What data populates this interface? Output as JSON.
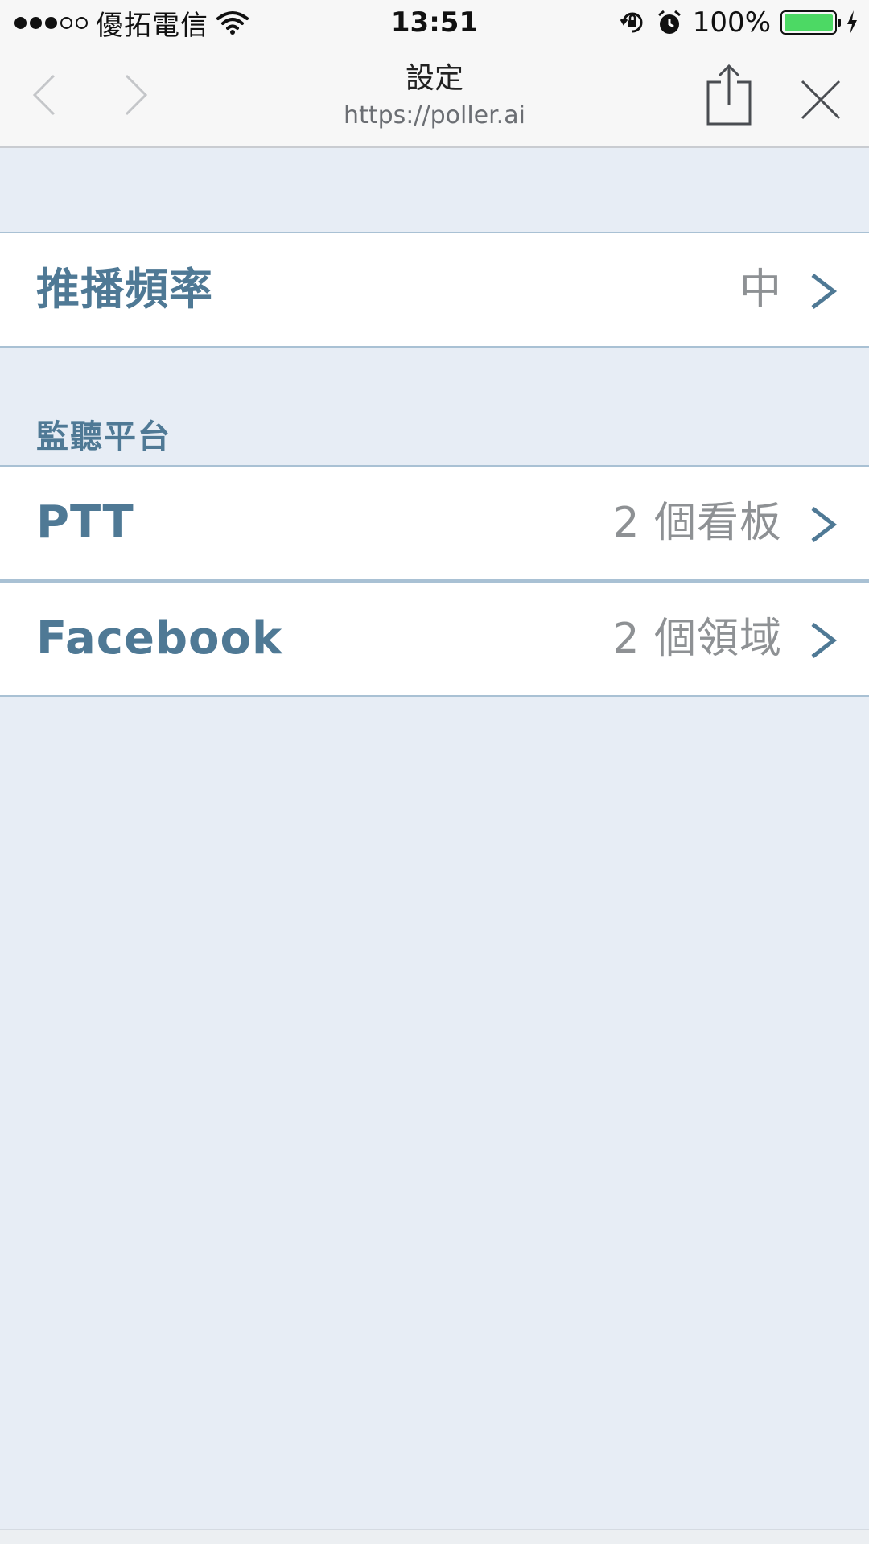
{
  "status_bar": {
    "carrier": "優拓電信",
    "time": "13:51",
    "battery_percent": "100%",
    "battery_level": 1.0
  },
  "browser": {
    "title": "設定",
    "url": "https://poller.ai"
  },
  "settings": {
    "push_frequency": {
      "label": "推播頻率",
      "value": "中"
    },
    "section_title": "監聽平台",
    "platforms": [
      {
        "label": "PTT",
        "value": "2 個看板"
      },
      {
        "label": "Facebook",
        "value": "2 個領域"
      }
    ]
  },
  "colors": {
    "accent": "#4f7995",
    "background": "#e7edf5",
    "divider": "#a9c1d4",
    "value_text": "#8e9194",
    "battery": "#4cd964"
  }
}
